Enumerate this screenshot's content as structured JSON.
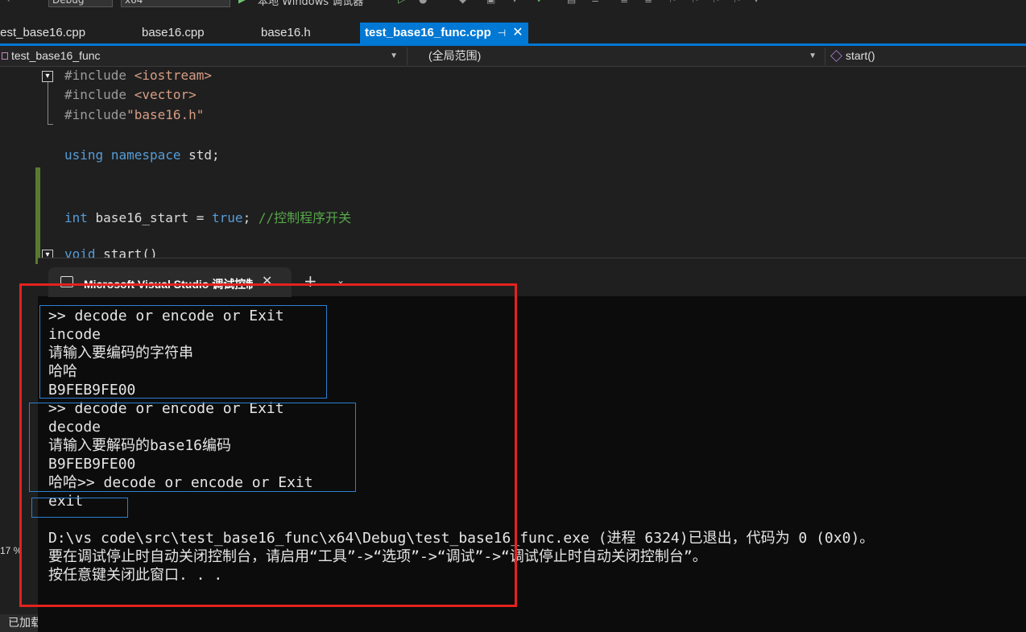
{
  "toolbar": {
    "config": "Debug",
    "platform": "x64",
    "debugger": "本地 Windows 调试器"
  },
  "tabs": [
    {
      "label": "test_base16.cpp"
    },
    {
      "label": "base16.cpp"
    },
    {
      "label": "base16.h"
    },
    {
      "label": "test_base16_func.cpp",
      "active": true
    }
  ],
  "tab_icons": {
    "pin": "pin-icon",
    "close": "close-icon"
  },
  "navbar": {
    "project": "test_base16_func",
    "scope": "(全局范围)",
    "member": "start()"
  },
  "code": {
    "line1_directive": "#include ",
    "line1_header": "<iostream>",
    "line2_directive": "#include ",
    "line2_header": "<vector>",
    "line3_directive": "#include",
    "line3_header": "\"base16.h\"",
    "line4_kw1": "using",
    "line4_kw2": "namespace",
    "line4_rest": " std;",
    "line5_type": "int",
    "line5_var": " base16_start = ",
    "line5_val": "true",
    "line5_semi": "; ",
    "line5_comment": "//控制程序开关",
    "line6_kw": "void",
    "line6_rest": " start()"
  },
  "console": {
    "title": "Microsoft Visual Studio 调试控制台",
    "plus": "+",
    "chevron": "⌄",
    "lines": [
      ">> decode or encode or Exit",
      "incode",
      "请输入要编码的字符串",
      "哈哈",
      "B9FEB9FE00",
      ">> decode or encode or Exit",
      "decode",
      "请输入要解码的base16编码",
      "B9FEB9FE00",
      "哈哈>> decode or encode or Exit",
      "exit",
      "",
      "D:\\vs code\\src\\test_base16_func\\x64\\Debug\\test_base16_func.exe (进程 6324)已退出，代码为 0 (0x0)。",
      "要在调试停止时自动关闭控制台，请启用“工具”->“选项”->“调试”->“调试停止时自动关闭控制台”。",
      "按任意键关闭此窗口. . ."
    ]
  },
  "zoom": "17 %",
  "status": "已加载"
}
